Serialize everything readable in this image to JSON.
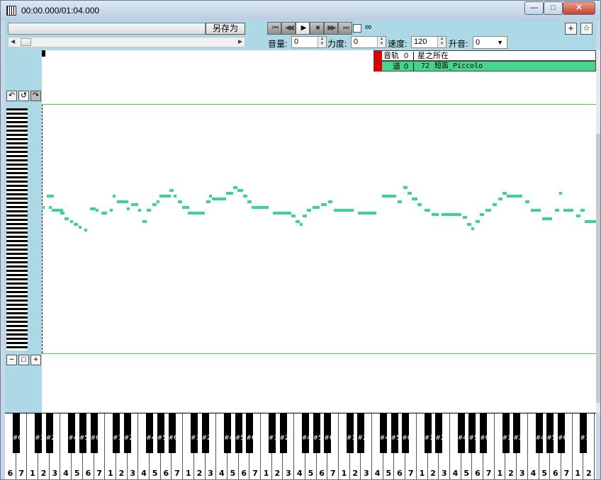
{
  "window": {
    "title": "00:00.000/01:04.000",
    "minimize": "—",
    "maximize": "□",
    "close": "✕"
  },
  "toolbar": {
    "save_as": "另存为",
    "loop_icon": "∞",
    "volume_label": "音量:",
    "volume_value": "0",
    "velocity_label": "力度:",
    "velocity_value": "0",
    "tempo_label": "速度:",
    "tempo_value": "120",
    "transpose_label": "升音:",
    "transpose_value": "0",
    "add": "+",
    "star": "☆",
    "transport": [
      "⏮",
      "◀◀",
      "▶",
      "■",
      "▶▶",
      "⏭"
    ]
  },
  "left_panel": {
    "undo": "↶",
    "reset": "↺",
    "redo": "↷",
    "zoom_out": "−",
    "zoom_fit": "□",
    "zoom_in": "+"
  },
  "tracks": {
    "track_label": "音轨",
    "track_num": "0",
    "track_name": "星之所在",
    "channel_label": "道",
    "channel_num": "0",
    "program_num": "72",
    "instrument": "短笛_Piccolo"
  },
  "colors": {
    "note": "#3bd68b",
    "grid_line": "#4ec84e",
    "panel": "#add8e6",
    "track_marker": "#e00000",
    "channel_row": "#47d48b"
  },
  "notes": [
    [
      0,
      220,
      4
    ],
    [
      7,
      204,
      10
    ],
    [
      10,
      220,
      4
    ],
    [
      14,
      224,
      16
    ],
    [
      26,
      228,
      6
    ],
    [
      32,
      236,
      6
    ],
    [
      40,
      240,
      4
    ],
    [
      45,
      244,
      6
    ],
    [
      52,
      248,
      4
    ],
    [
      60,
      252,
      4
    ],
    [
      68,
      222,
      8
    ],
    [
      76,
      224,
      4
    ],
    [
      84,
      228,
      8
    ],
    [
      96,
      224,
      4
    ],
    [
      100,
      204,
      4
    ],
    [
      106,
      212,
      16
    ],
    [
      120,
      222,
      4
    ],
    [
      126,
      216,
      10
    ],
    [
      136,
      224,
      4
    ],
    [
      142,
      240,
      6
    ],
    [
      148,
      224,
      6
    ],
    [
      156,
      216,
      6
    ],
    [
      162,
      212,
      4
    ],
    [
      166,
      204,
      16
    ],
    [
      180,
      196,
      6
    ],
    [
      186,
      204,
      4
    ],
    [
      192,
      212,
      6
    ],
    [
      198,
      220,
      10
    ],
    [
      206,
      228,
      24
    ],
    [
      232,
      212,
      6
    ],
    [
      236,
      204,
      4
    ],
    [
      240,
      208,
      20
    ],
    [
      260,
      200,
      10
    ],
    [
      270,
      192,
      6
    ],
    [
      276,
      196,
      8
    ],
    [
      284,
      204,
      6
    ],
    [
      290,
      212,
      6
    ],
    [
      296,
      220,
      24
    ],
    [
      326,
      228,
      26
    ],
    [
      352,
      232,
      6
    ],
    [
      358,
      240,
      6
    ],
    [
      364,
      244,
      4
    ],
    [
      368,
      232,
      6
    ],
    [
      374,
      224,
      6
    ],
    [
      382,
      220,
      10
    ],
    [
      394,
      216,
      8
    ],
    [
      404,
      212,
      6
    ],
    [
      412,
      224,
      28
    ],
    [
      446,
      228,
      26
    ],
    [
      480,
      204,
      20
    ],
    [
      502,
      212,
      6
    ],
    [
      510,
      192,
      6
    ],
    [
      516,
      200,
      6
    ],
    [
      522,
      208,
      8
    ],
    [
      530,
      216,
      6
    ],
    [
      540,
      224,
      8
    ],
    [
      550,
      230,
      10
    ],
    [
      564,
      230,
      28
    ],
    [
      594,
      234,
      6
    ],
    [
      600,
      244,
      6
    ],
    [
      606,
      250,
      4
    ],
    [
      612,
      240,
      6
    ],
    [
      618,
      230,
      6
    ],
    [
      626,
      224,
      8
    ],
    [
      636,
      216,
      6
    ],
    [
      644,
      208,
      6
    ],
    [
      650,
      200,
      6
    ],
    [
      656,
      204,
      22
    ],
    [
      682,
      212,
      6
    ],
    [
      690,
      224,
      14
    ],
    [
      706,
      236,
      14
    ],
    [
      724,
      224,
      6
    ],
    [
      730,
      200,
      4
    ],
    [
      736,
      224,
      14
    ],
    [
      754,
      232,
      6
    ],
    [
      760,
      224,
      6
    ],
    [
      766,
      240,
      16
    ]
  ],
  "keyboard": {
    "octaves": 7,
    "white_labels": [
      "6",
      "7",
      "1",
      "2",
      "3",
      "4",
      "5",
      "6",
      "7",
      "1",
      "2",
      "3",
      "4",
      "5",
      "6",
      "7",
      "1",
      "2",
      "3",
      "4",
      "5",
      "6",
      "7",
      "1",
      "2",
      "3",
      "4",
      "5",
      "6",
      "7",
      "1",
      "2",
      "3",
      "4",
      "5",
      "6",
      "7",
      "1",
      "2",
      "3",
      "4",
      "5",
      "6",
      "7",
      "1",
      "2",
      "3",
      "4",
      "5",
      "6",
      "7",
      "1",
      "2"
    ],
    "black_labels": [
      "#6",
      "#1",
      "#2",
      "#4",
      "#5",
      "#6",
      "#1",
      "#2",
      "#4",
      "#5",
      "#6",
      "#1",
      "#2",
      "#4",
      "#5",
      "#6",
      "#1",
      "#2",
      "#4",
      "#5",
      "#6",
      "#1",
      "#2",
      "#4",
      "#5",
      "#6",
      "#1",
      "#2",
      "#4",
      "#5",
      "#6",
      "#1",
      "#2",
      "#4",
      "#5",
      "#6",
      "#1"
    ]
  }
}
